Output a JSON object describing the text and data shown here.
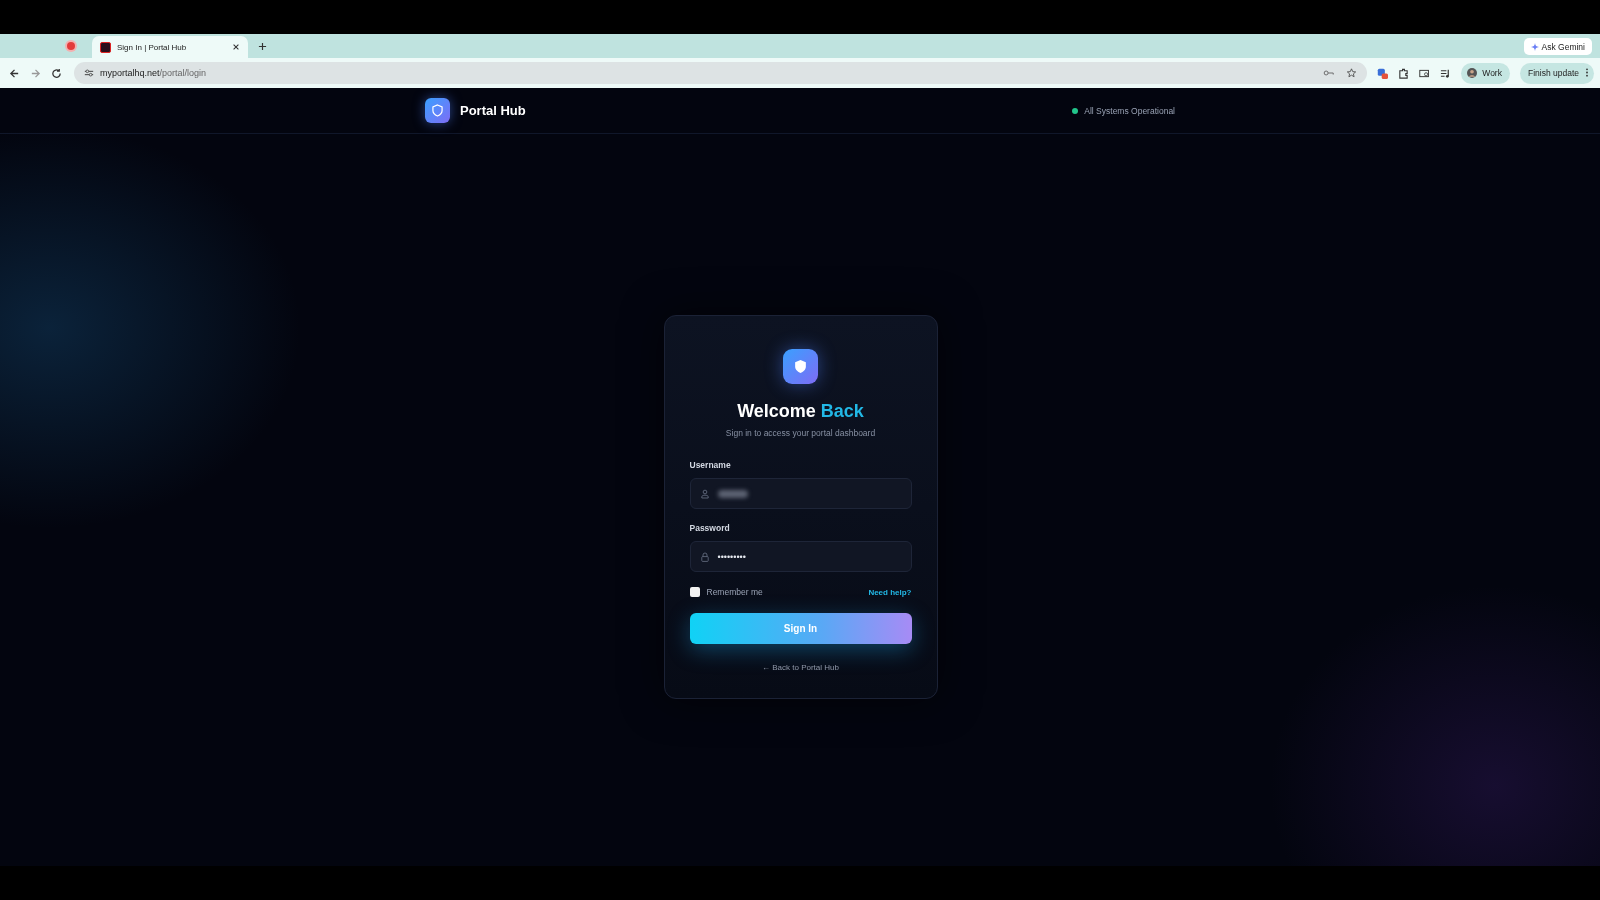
{
  "browser": {
    "tabs": [
      {
        "title": "Sign In | Portal Hub",
        "selected": true
      }
    ],
    "ask_button": "Ask Gemini",
    "url_host": "myportalhq.net",
    "url_path": "/portal/login",
    "profile": "Work",
    "update_button": "Finish update"
  },
  "header": {
    "brand": "Portal Hub",
    "status": {
      "label": "All Systems Operational",
      "color": "#22c58b"
    }
  },
  "card": {
    "title": "Welcome",
    "title_highlight": "Back",
    "subtitle": "Sign in to access your portal dashboard",
    "fields": [
      {
        "label": "Username",
        "kind": "user",
        "value_blurred": true
      },
      {
        "label": "Password",
        "kind": "password",
        "value": "•••••••••"
      }
    ],
    "remember": {
      "label": "Remember me",
      "checked": false
    },
    "help_link": "Need help?",
    "submit": "Sign In",
    "back_link": "← Back to Portal Hub"
  }
}
